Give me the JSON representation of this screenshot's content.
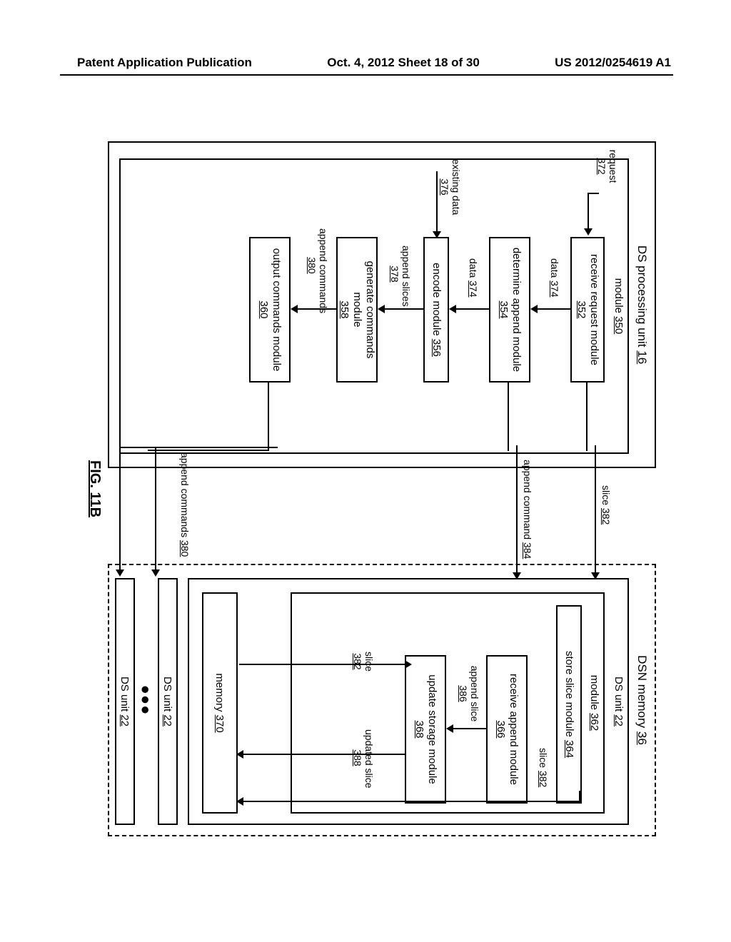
{
  "header": {
    "left": "Patent Application Publication",
    "mid": "Oct. 4, 2012   Sheet 18 of 30",
    "right": "US 2012/0254619 A1"
  },
  "figure_label": "FIG. 11B",
  "dsproc": {
    "title": "DS processing unit",
    "title_ref": "16",
    "module_label": "module",
    "module_ref": "350",
    "recv_req": "receive request module",
    "recv_req_ref": "352",
    "det_append": "determine append module",
    "det_append_ref": "354",
    "encode": "encode module",
    "encode_ref": "356",
    "gen_cmd": "generate commands module",
    "gen_cmd_ref": "358",
    "out_cmd": "output commands module",
    "out_cmd_ref": "360"
  },
  "labels": {
    "request": "request",
    "request_ref": "372",
    "data": "data",
    "data_ref": "374",
    "existing_data": "existing data",
    "existing_data_ref": "376",
    "append_slices": "append slices",
    "append_slices_ref": "378",
    "append_commands": "append commands",
    "append_commands_ref": "380",
    "slice": "slice",
    "slice_ref": "382",
    "append_command": "append command",
    "append_command_ref": "384",
    "append_slice": "append slice",
    "append_slice_ref": "386",
    "updated_slice": "updated slice",
    "updated_slice_ref": "388"
  },
  "dsn": {
    "title": "DSN memory",
    "title_ref": "36",
    "dsunit": "DS unit",
    "dsunit_ref": "22",
    "module_label": "module",
    "module_ref": "362",
    "store_slice": "store slice module",
    "store_slice_ref": "364",
    "recv_append": "receive append module",
    "recv_append_ref": "366",
    "upd_storage": "update storage module",
    "upd_storage_ref": "368",
    "memory": "memory",
    "memory_ref": "370"
  }
}
